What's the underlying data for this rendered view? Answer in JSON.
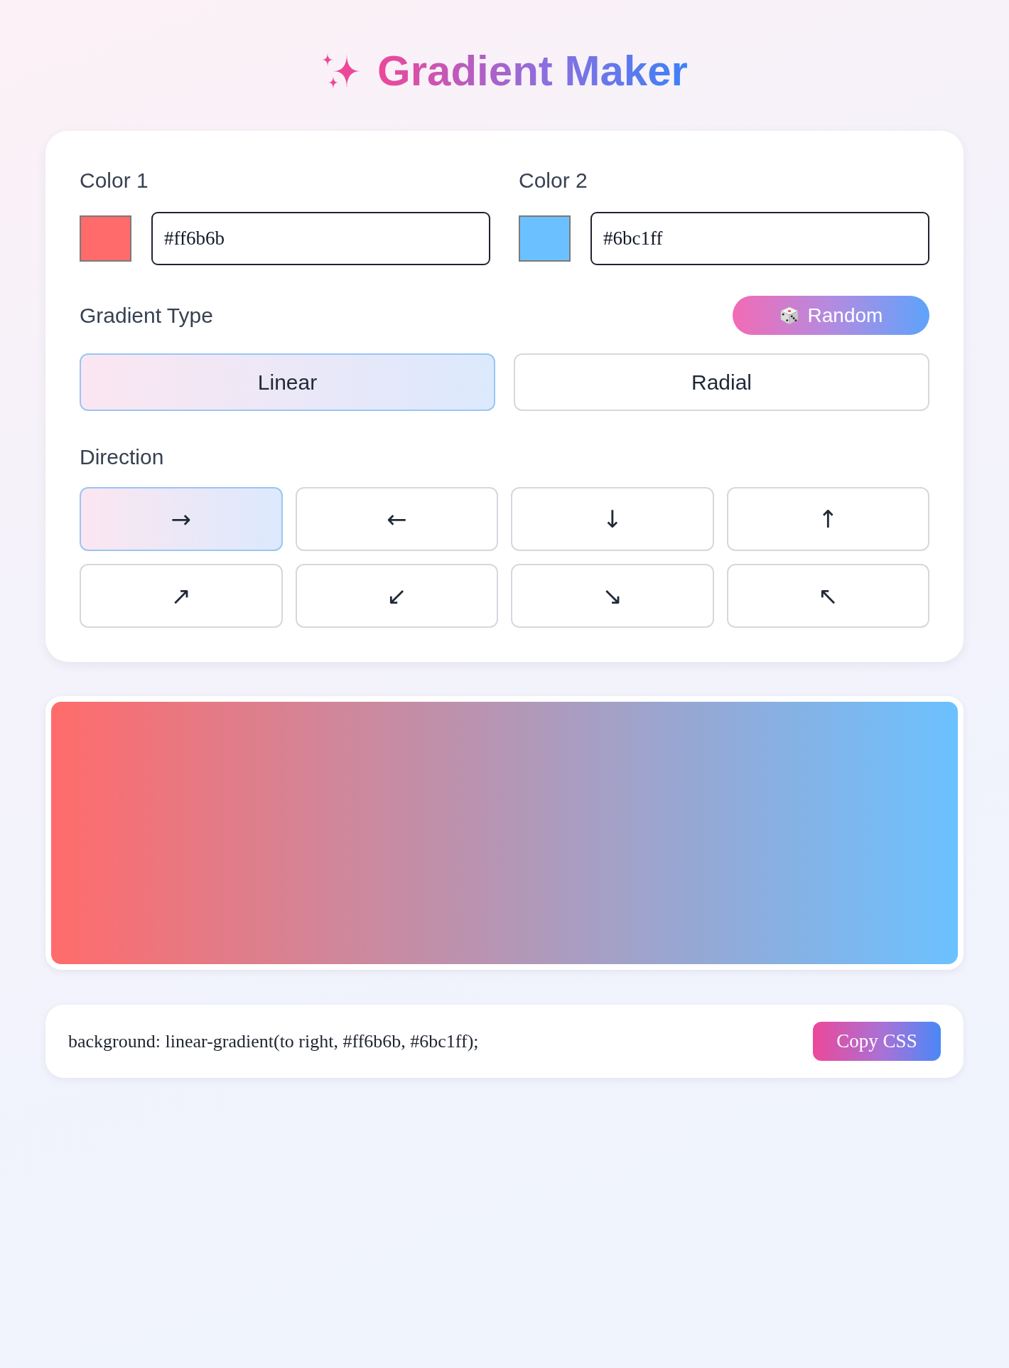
{
  "header": {
    "title": "Gradient Maker"
  },
  "colors": [
    {
      "label": "Color 1",
      "value": "#ff6b6b",
      "color": "#ff6b6b"
    },
    {
      "label": "Color 2",
      "value": "#6bc1ff",
      "color": "#6bc1ff"
    }
  ],
  "gradient_type": {
    "label": "Gradient Type",
    "random_button": "Random",
    "options": [
      {
        "label": "Linear",
        "selected": true
      },
      {
        "label": "Radial",
        "selected": false
      }
    ]
  },
  "direction": {
    "label": "Direction",
    "options": [
      {
        "symbol": "→",
        "selected": true
      },
      {
        "symbol": "←",
        "selected": false
      },
      {
        "symbol": "↓",
        "selected": false
      },
      {
        "symbol": "↑",
        "selected": false
      },
      {
        "symbol": "↗",
        "selected": false
      },
      {
        "symbol": "↙",
        "selected": false
      },
      {
        "symbol": "↘",
        "selected": false
      },
      {
        "symbol": "↖",
        "selected": false
      }
    ]
  },
  "css_output": {
    "code": "background: linear-gradient(to right, #ff6b6b, #6bc1ff);",
    "copy_button": "Copy CSS"
  }
}
